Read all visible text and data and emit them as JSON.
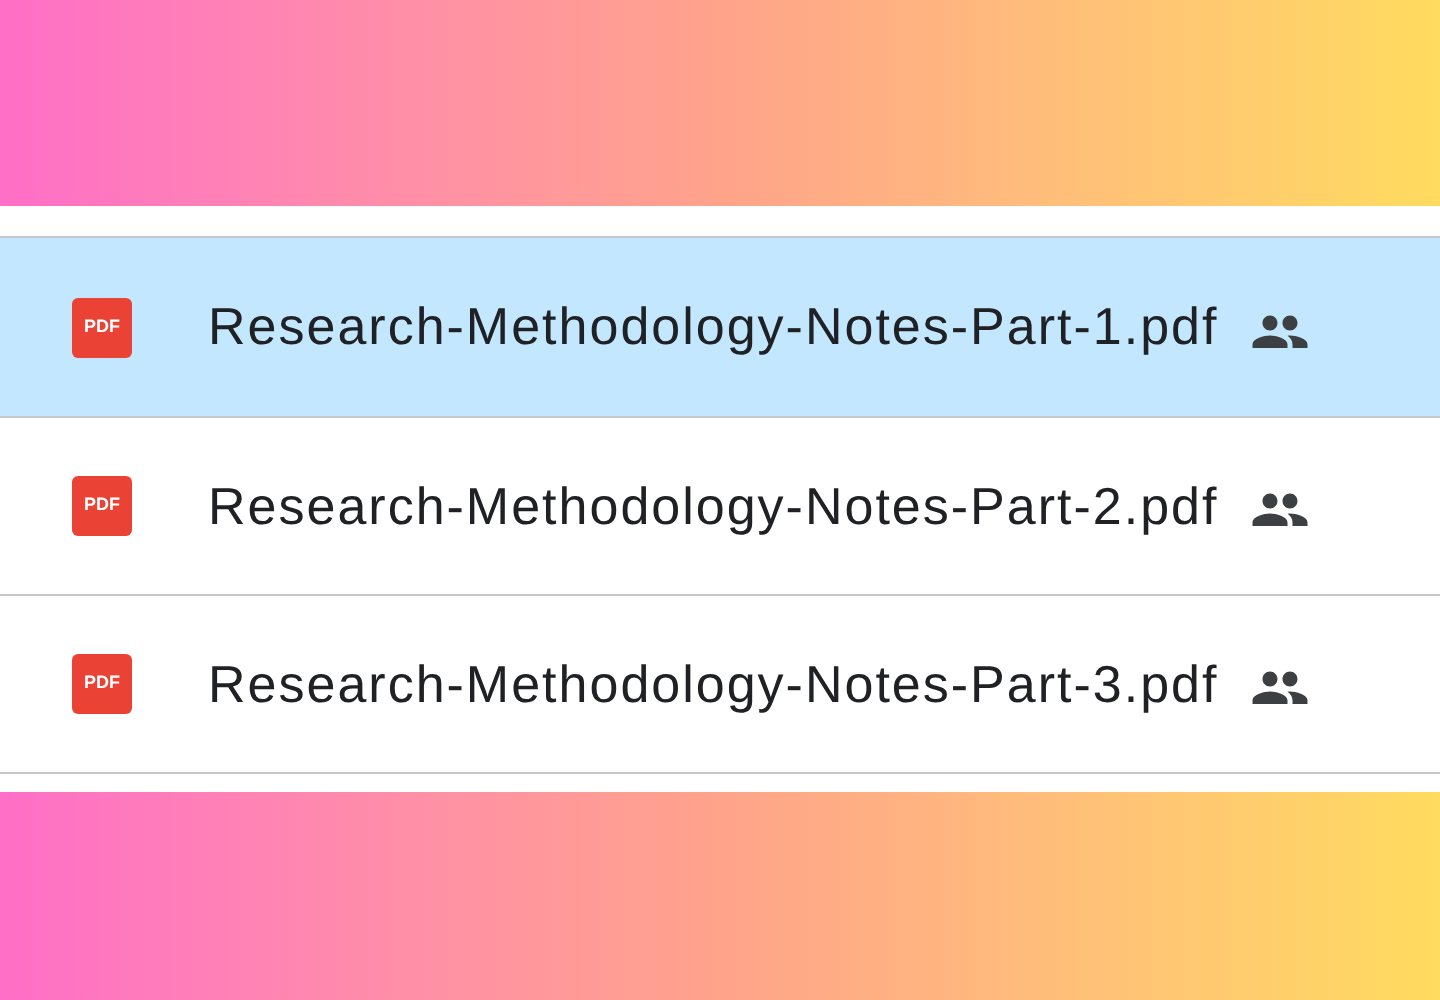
{
  "files": [
    {
      "name": "Research-Methodology-Notes-Part-1.pdf",
      "type_label": "PDF",
      "shared": true,
      "selected": true
    },
    {
      "name": "Research-Methodology-Notes-Part-2.pdf",
      "type_label": "PDF",
      "shared": true,
      "selected": false
    },
    {
      "name": "Research-Methodology-Notes-Part-3.pdf",
      "type_label": "PDF",
      "shared": true,
      "selected": false
    }
  ]
}
